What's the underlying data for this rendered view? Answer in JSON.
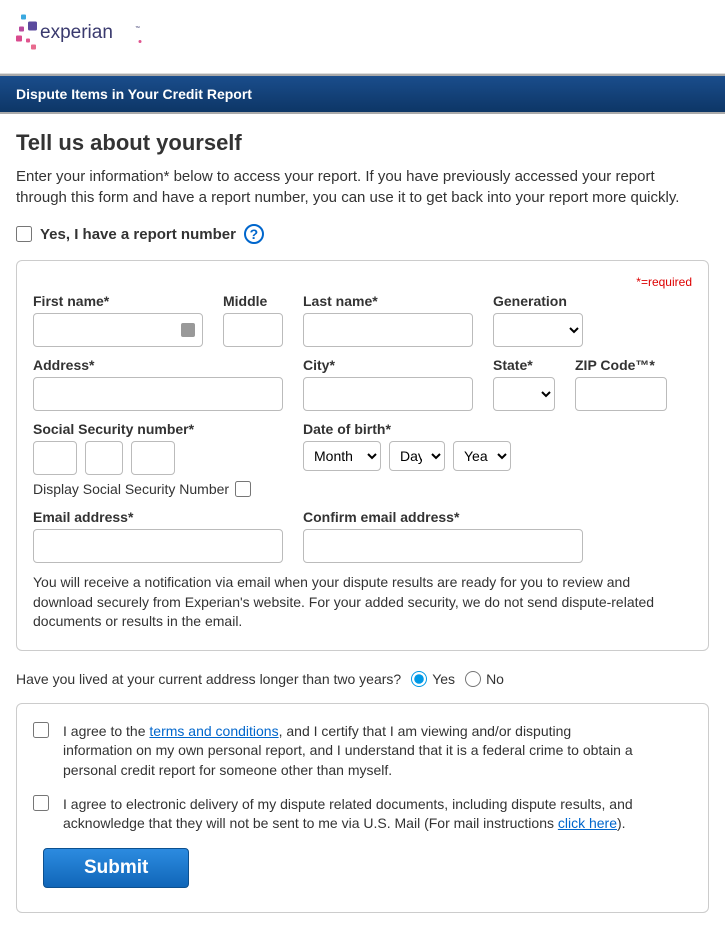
{
  "brand": "experian",
  "header": {
    "title": "Dispute Items in Your Credit Report"
  },
  "page": {
    "heading": "Tell us about yourself",
    "intro": "Enter your information* below to access your report. If you have previously accessed your report through this form and have a report number, you can use it to get back into your report more quickly.",
    "report_number_label": "Yes, I have a report number"
  },
  "form": {
    "required_note": "*=required",
    "first_name": "First name*",
    "middle": "Middle",
    "last_name": "Last name*",
    "generation": "Generation",
    "address": "Address*",
    "city": "City*",
    "state": "State*",
    "zip": "ZIP Code™*",
    "ssn": "Social Security number*",
    "ssn_display": "Display Social Security Number",
    "dob": "Date of birth*",
    "dob_month": "Month",
    "dob_day": "Day",
    "dob_year": "Year",
    "email": "Email address*",
    "confirm_email": "Confirm email address*",
    "email_note": "You will receive a notification via email when your dispute results are ready for you to review and download se­curely from Experian's website. For your added security, we do not send dispute-related documents or results in the email."
  },
  "address_question": {
    "text": "Have you lived at your current address longer than two years?",
    "yes": "Yes",
    "no": "No"
  },
  "agreements": {
    "terms_prefix": "I agree to the ",
    "terms_link": "terms and conditions",
    "terms_suffix": ", and I certify that I am viewing and/or disputing information on my own personal report, and I understand that it is a federal crime to obtain a personal credit report for someone other than myself.",
    "electronic_prefix": "I agree to electronic delivery of my dispute related documents, including dispute results, and ac­knowledge that they will not be sent to me via U.S. Mail (For mail instructions ",
    "electronic_link": "click here",
    "electronic_suffix": ")."
  },
  "submit": "Submit"
}
